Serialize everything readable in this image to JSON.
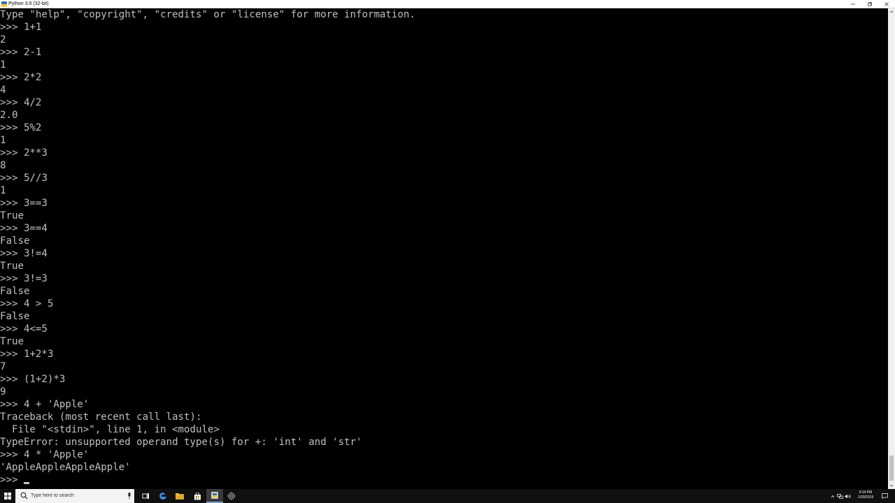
{
  "window": {
    "title": "Python 3.6 (32-bit)"
  },
  "console": {
    "lines": [
      "Type \"help\", \"copyright\", \"credits\" or \"license\" for more information.",
      ">>> 1+1",
      "2",
      ">>> 2-1",
      "1",
      ">>> 2*2",
      "4",
      ">>> 4/2",
      "2.0",
      ">>> 5%2",
      "1",
      ">>> 2**3",
      "8",
      ">>> 5//3",
      "1",
      ">>> 3==3",
      "True",
      ">>> 3==4",
      "False",
      ">>> 3!=4",
      "True",
      ">>> 3!=3",
      "False",
      ">>> 4 > 5",
      "False",
      ">>> 4<=5",
      "True",
      ">>> 1+2*3",
      "7",
      ">>> (1+2)*3",
      "9",
      ">>> 4 + 'Apple'",
      "Traceback (most recent call last):",
      "  File \"<stdin>\", line 1, in <module>",
      "TypeError: unsupported operand type(s) for +: 'int' and 'str'",
      ">>> 4 * 'Apple'",
      "'AppleAppleAppleApple'"
    ],
    "prompt": ">>> "
  },
  "taskbar": {
    "search_placeholder": "Type here to search",
    "time": "9:14 PM",
    "date": "1/30/2019"
  },
  "colors": {
    "console_bg": "#000000",
    "console_fg": "#c0c0c0",
    "taskbar_bg": "#101010",
    "edge_blue": "#3c8ee6",
    "folder_yellow": "#f0c040"
  },
  "icons": {
    "app": "python-icon",
    "minimize": "minimize-icon",
    "maximize": "maximize-icon",
    "close": "close-icon",
    "start": "windows-logo-icon",
    "search": "search-icon",
    "mic": "microphone-icon",
    "task_view": "task-view-icon",
    "edge": "edge-icon",
    "explorer": "folder-icon",
    "store": "store-icon",
    "python": "python-icon",
    "settings": "gear-icon"
  }
}
